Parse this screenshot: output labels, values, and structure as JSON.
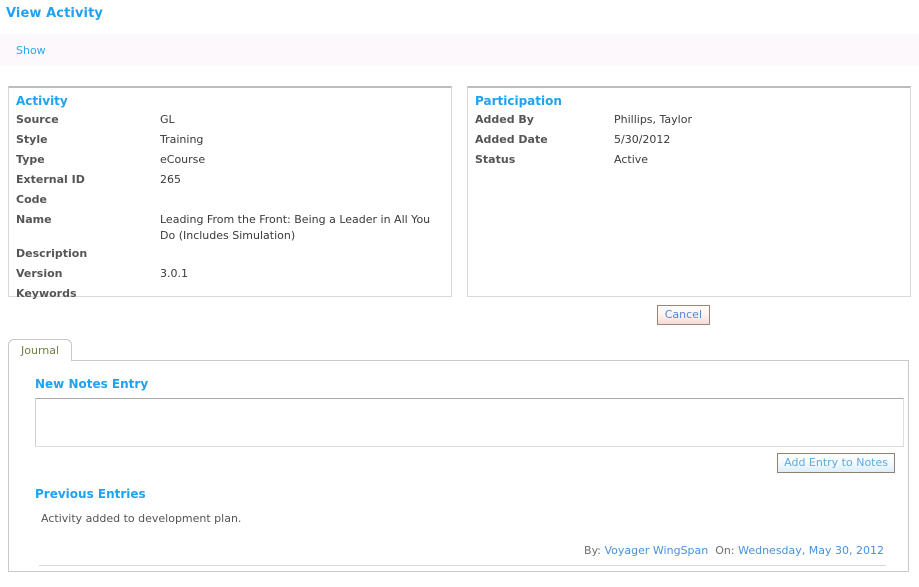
{
  "page": {
    "title": "View Activity"
  },
  "toolbar": {
    "show_label": "Show"
  },
  "activity": {
    "title": "Activity",
    "fields": [
      {
        "label": "Source",
        "value": "GL"
      },
      {
        "label": "Style",
        "value": "Training"
      },
      {
        "label": "Type",
        "value": "eCourse"
      },
      {
        "label": "External ID",
        "value": "265"
      },
      {
        "label": "Code",
        "value": ""
      },
      {
        "label": "Name",
        "value": "Leading From the Front: Being a Leader in All You Do (Includes Simulation)"
      },
      {
        "label": "Description",
        "value": ""
      },
      {
        "label": "Version",
        "value": "3.0.1"
      },
      {
        "label": "Keywords",
        "value": ""
      }
    ]
  },
  "participation": {
    "title": "Participation",
    "fields": [
      {
        "label": "Added By",
        "value": "Phillips, Taylor"
      },
      {
        "label": "Added Date",
        "value": "5/30/2012"
      },
      {
        "label": "Status",
        "value": "Active"
      }
    ]
  },
  "actions": {
    "cancel_label": "Cancel"
  },
  "journal": {
    "tab_label": "Journal",
    "new_notes_title": "New Notes Entry",
    "notes_value": "",
    "notes_placeholder": "",
    "add_entry_label": "Add Entry to Notes",
    "previous_entries_title": "Previous Entries",
    "entries": [
      {
        "text": "Activity added to development plan.",
        "by_label": "By:",
        "by_value": "Voyager WingSpan",
        "on_label": "On:",
        "on_value": "Wednesday, May 30, 2012"
      }
    ]
  },
  "colors": {
    "accent_blue": "#1fa2f0",
    "link_blue": "#4a90d9",
    "tab_green": "#6d8040",
    "show_bar_bg": "#fdf8fc"
  }
}
